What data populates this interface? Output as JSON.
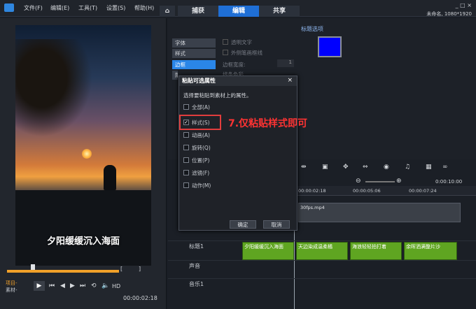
{
  "menu": {
    "items": [
      "文件(F)",
      "编辑(E)",
      "工具(T)",
      "设置(S)",
      "帮助(H)"
    ]
  },
  "tabs": {
    "capture": "捕获",
    "edit": "编辑",
    "share": "共享"
  },
  "project": {
    "info": "未命名, 1080*1920"
  },
  "preview": {
    "caption": "夕阳缓缓沉入海面",
    "project_label": "项目-",
    "clip_label": "素材-",
    "timecode": "00:00:02:18",
    "hd": "HD"
  },
  "options": {
    "title": "标题选项",
    "items": [
      "字体",
      "样式",
      "边框",
      "阴影"
    ],
    "transparent_text": "透明文字",
    "outer_border": "外侧笔画框线",
    "border_width_label": "边框宽度:",
    "border_width_value": "1",
    "color_label": "线条色彩"
  },
  "dialog": {
    "title": "粘贴可选属性",
    "close": "×",
    "prompt": "选择要粘贴到素材上的属性。",
    "all": "全部(A)",
    "style": "样式(S)",
    "animation": "动画(A)",
    "rotate": "旋转(Q)",
    "position": "位置(P)",
    "filter": "滤镜(F)",
    "motion": "动作(M)",
    "ok": "确定",
    "cancel": "取消"
  },
  "annotation": {
    "label": "7.仅粘贴样式即可"
  },
  "timeline": {
    "timecode": "0:00:10:00",
    "ruler": [
      "00:00:02:18",
      "00:00:05:06",
      "00:00:07:24"
    ],
    "video_file": "30fps.mp4",
    "tracks": {
      "title": "标题1",
      "voice": "声音",
      "music": "音乐1"
    },
    "clips": [
      "夕阳缓缓沉入海面",
      "天边染成温柔橘",
      "海浪轻轻拍打着",
      "余晖洒满整片沙"
    ]
  }
}
